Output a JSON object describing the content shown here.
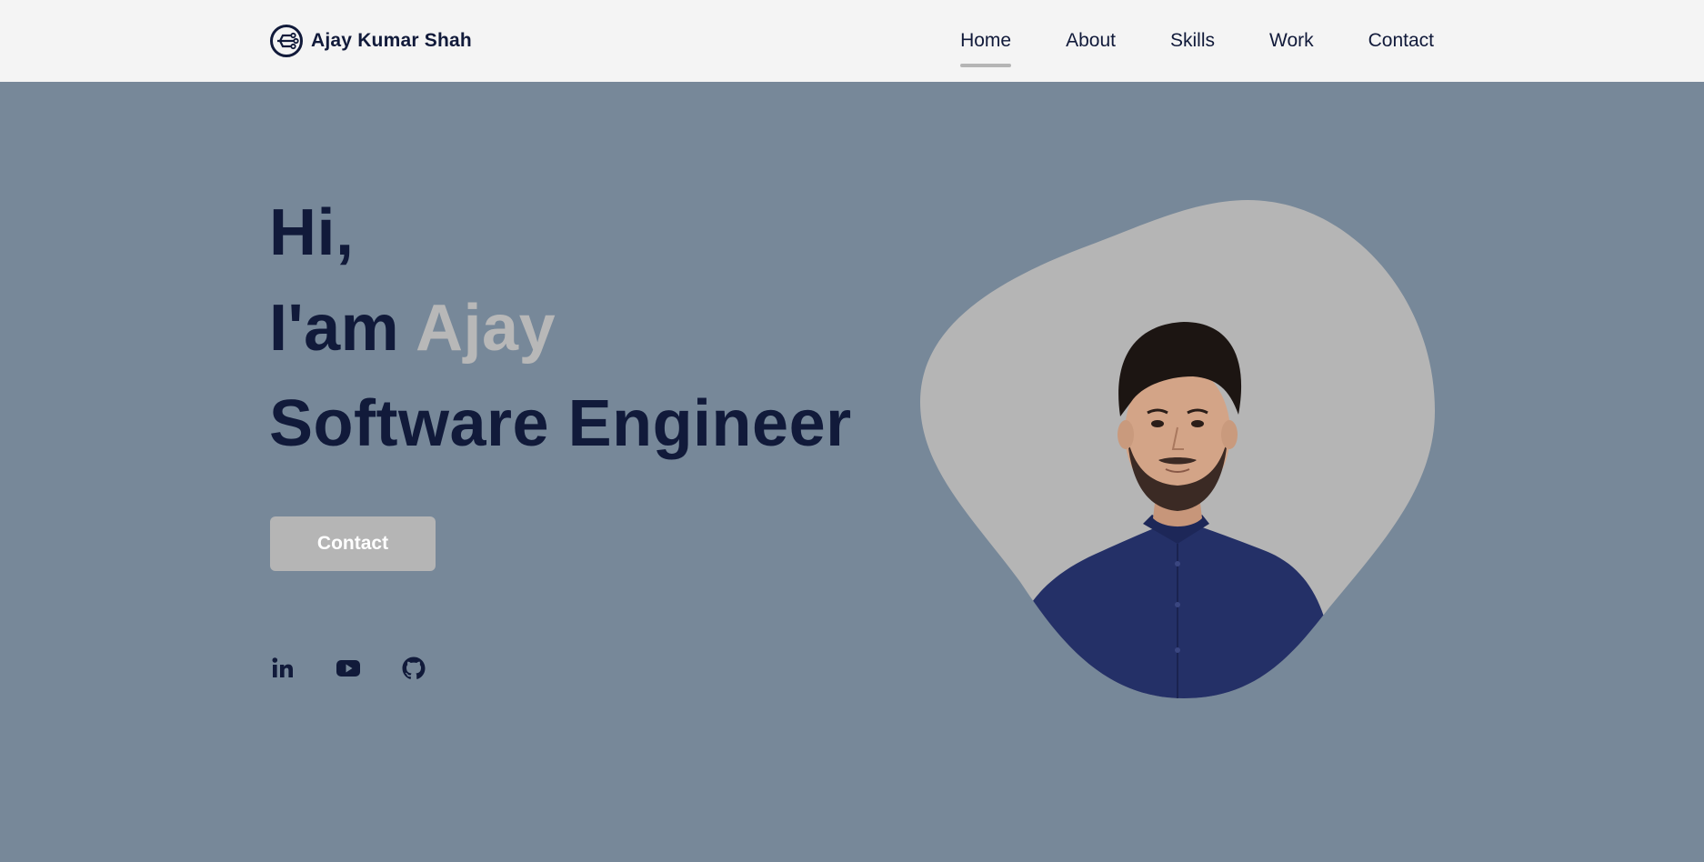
{
  "header": {
    "logo_text": "Ajay Kumar Shah",
    "nav": [
      {
        "label": "Home",
        "active": true
      },
      {
        "label": "About",
        "active": false
      },
      {
        "label": "Skills",
        "active": false
      },
      {
        "label": "Work",
        "active": false
      },
      {
        "label": "Contact",
        "active": false
      }
    ]
  },
  "hero": {
    "greeting": "Hi,",
    "intro_prefix": "I'am ",
    "intro_name": "Ajay",
    "role": "Software Engineer",
    "cta_label": "Contact",
    "socials": [
      {
        "icon": "linkedin-icon"
      },
      {
        "icon": "youtube-icon"
      },
      {
        "icon": "github-icon"
      }
    ]
  },
  "colors": {
    "header_bg": "#f4f4f4",
    "hero_bg": "#778899",
    "text_dark": "#111a3a",
    "accent_gray": "#b5b5b5",
    "shirt": "#243067"
  }
}
